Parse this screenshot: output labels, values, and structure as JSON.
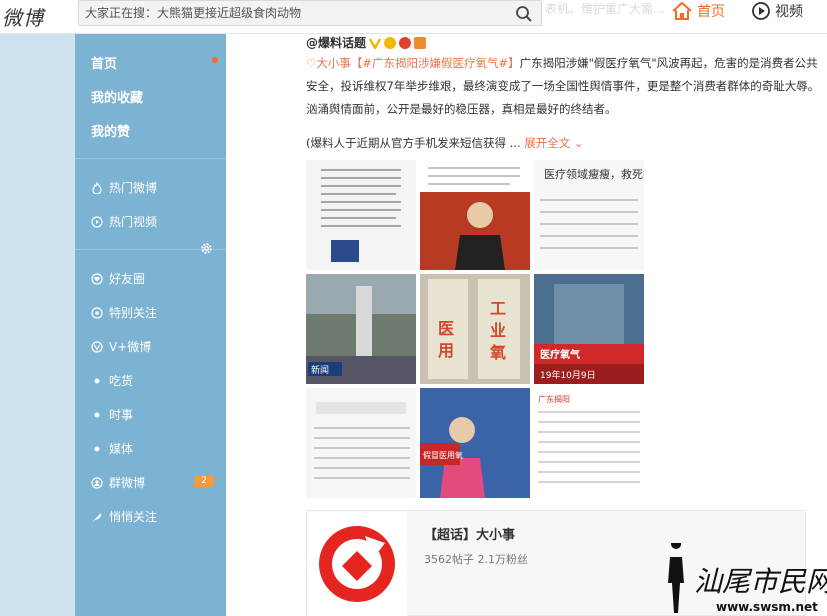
{
  "header": {
    "logo": "微博",
    "search_placeholder": "大家正在搜：大熊猫更接近超级食肉动物",
    "bg_text": "表机、维护重广大需...",
    "nav_home": "首页",
    "nav_video": "视频"
  },
  "sidebar": {
    "main_items": [
      "首页",
      "我的收藏",
      "我的赞"
    ],
    "items": [
      {
        "label": "热门微博",
        "icon": "fire-icon"
      },
      {
        "label": "热门视频",
        "icon": "play-icon"
      },
      {
        "label": "好友圈",
        "icon": "heart-icon"
      },
      {
        "label": "特别关注",
        "icon": "star-icon"
      },
      {
        "label": "V+微博",
        "icon": "v-plus-icon"
      },
      {
        "label": "吃货",
        "icon": "dot-icon"
      },
      {
        "label": "时事",
        "icon": "dot-icon"
      },
      {
        "label": "媒体",
        "icon": "dot-icon"
      },
      {
        "label": "群微博",
        "icon": "group-icon"
      },
      {
        "label": "悄悄关注",
        "icon": "feather-icon"
      }
    ],
    "group_badge": "2"
  },
  "post": {
    "author": "@爆料话题",
    "topic_tag": "大小事",
    "hashtag": "【#广东揭阳涉嫌假医疗氧气#】",
    "text": "广东揭阳涉嫌\"假医疗氧气\"风波再起，危害的是消费者公共安全，投诉维权7年举步维艰，最终演变成了一场全国性舆情事件，更是整个消费者群体的奇耻大辱。 汹涌舆情面前，公开是最好的稳压器，真相是最好的终结者。",
    "more_text": "(爆料人于近期从官方手机发来短信获得 ...",
    "expand": "展开全文",
    "images": [
      {
        "caption": ""
      },
      {
        "caption": ""
      },
      {
        "caption": "医疗领域瘦瘦，救死扶"
      },
      {
        "caption": "新闻"
      },
      {
        "caption": "医 用 工 业 氧"
      },
      {
        "caption": "19年10月9日"
      },
      {
        "caption": "假冒医用氧"
      },
      {
        "caption": "假冒医用氧"
      },
      {
        "caption": "广东揭阳"
      }
    ]
  },
  "topic_card": {
    "title": "【超话】大小事",
    "stats": "3562帖子 2.1万粉丝"
  },
  "watermark": {
    "text": "汕尾市民网",
    "url": "www.swsm.net"
  }
}
